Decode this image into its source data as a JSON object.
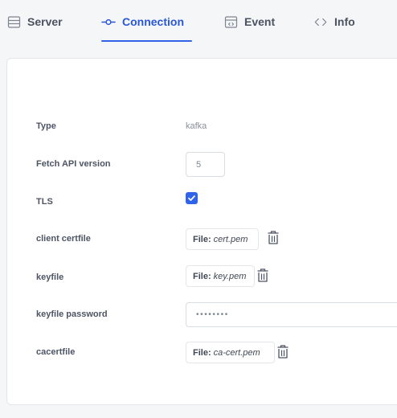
{
  "tabs": [
    {
      "label": "Server",
      "icon": "server-icon"
    },
    {
      "label": "Connection",
      "icon": "connection-icon",
      "active": true
    },
    {
      "label": "Event",
      "icon": "event-icon"
    },
    {
      "label": "Info",
      "icon": "code-icon"
    }
  ],
  "form": {
    "type_label": "Type",
    "type_value": "kafka",
    "fetch_api_version_label": "Fetch API version",
    "fetch_api_version_value": "5",
    "tls_label": "TLS",
    "tls_checked": true,
    "client_certfile_label": "client certfile",
    "client_certfile_prefix": "File:",
    "client_certfile_name": "cert.pem",
    "keyfile_label": "keyfile",
    "keyfile_prefix": "File:",
    "keyfile_name": "key.pem",
    "keyfile_password_label": "keyfile password",
    "keyfile_password_value": "••••••••",
    "cacertfile_label": "cacertfile",
    "cacertfile_prefix": "File:",
    "cacertfile_name": "ca-cert.pem"
  },
  "colors": {
    "accent": "#2f63ea",
    "text": "#4d5564",
    "muted": "#8a909b",
    "panel_border": "#e2e5ea"
  }
}
